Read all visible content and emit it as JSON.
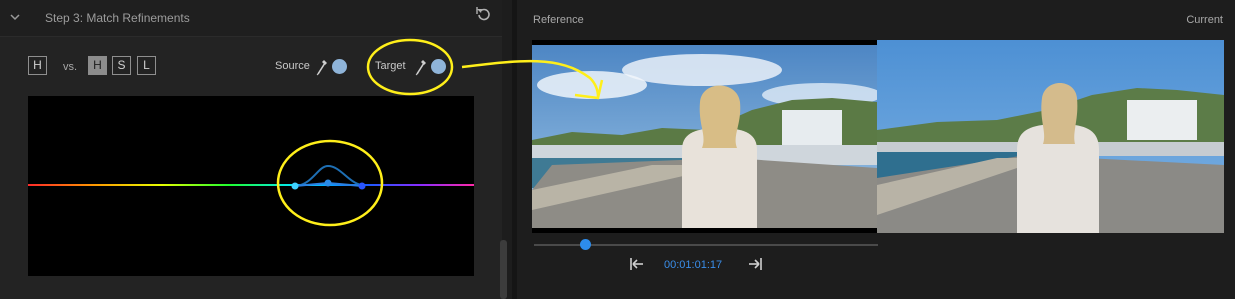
{
  "section": {
    "title": "Step 3: Match Refinements"
  },
  "hsl": {
    "h_left": "H",
    "vs": "vs.",
    "h": "H",
    "s": "S",
    "l": "L",
    "active": "H"
  },
  "pickers": {
    "source_label": "Source",
    "target_label": "Target",
    "swatch_color": "#8fb4d9"
  },
  "viewer": {
    "reference_label": "Reference",
    "current_label": "Current"
  },
  "playback": {
    "timecode": "00:01:01:17",
    "accent_color": "#2d8ceb"
  },
  "annotation_color": "#ffef1a"
}
